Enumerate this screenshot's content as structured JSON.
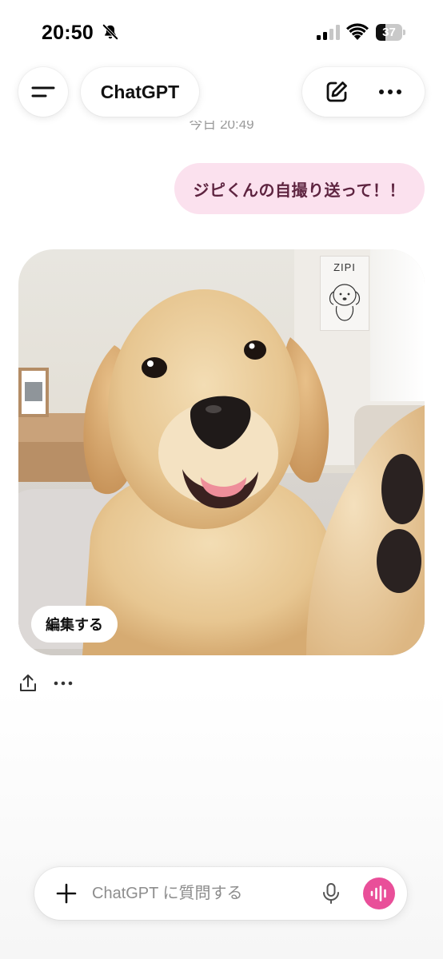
{
  "status_bar": {
    "time": "20:50",
    "battery_level": "37",
    "battery_fraction": 0.37
  },
  "header": {
    "title": "ChatGPT",
    "menu_icon": "menu-icon",
    "new_chat_icon": "compose-icon",
    "more_icon": "more-icon"
  },
  "chat": {
    "timestamp": "今日 20:49",
    "user_message": "ジピくんの自撮り送って！！",
    "image": {
      "description_icon": "generated-image",
      "poster_text": "ZIPI",
      "edit_label": "編集する"
    },
    "actions": [
      "share-icon",
      "more-icon"
    ]
  },
  "composer": {
    "placeholder": "ChatGPT に質問する",
    "value": ""
  },
  "colors": {
    "user_bubble_bg": "#fbe1ee",
    "user_bubble_text": "#5e2440",
    "voice_button": "#e94f99"
  }
}
